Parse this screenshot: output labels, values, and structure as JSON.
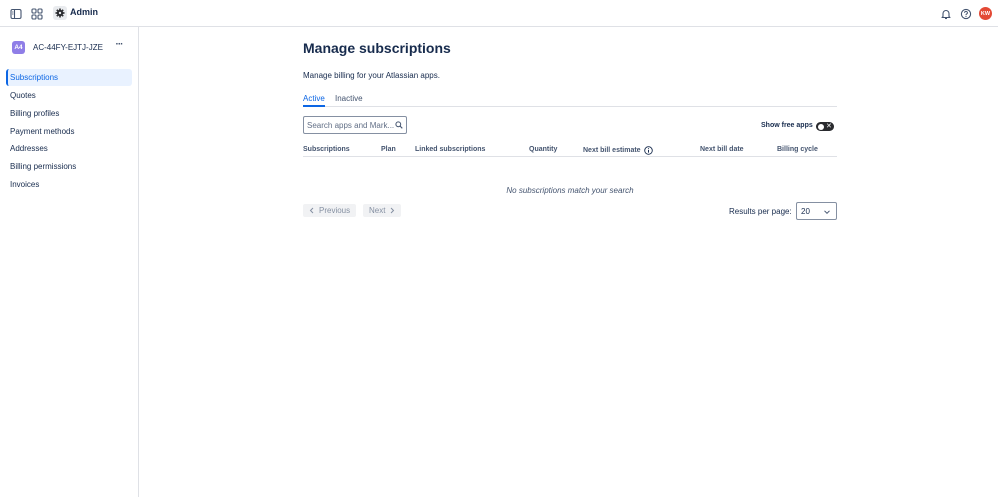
{
  "topbar": {
    "app_title": "Admin",
    "avatar_initials": "KW",
    "avatar_color": "#e34935",
    "icons": [
      "sidebar-toggle-icon",
      "app-switcher-icon",
      "gear-icon",
      "bell-icon",
      "help-icon"
    ]
  },
  "sidebar": {
    "org_badge": "A4",
    "org_badge_color": "#8f7ee7",
    "org_name": "AC-44FY-EJTJ-JZE",
    "more_label": "···",
    "items": [
      {
        "label": "Subscriptions",
        "active": true
      },
      {
        "label": "Quotes",
        "active": false
      },
      {
        "label": "Billing profiles",
        "active": false
      },
      {
        "label": "Payment methods",
        "active": false
      },
      {
        "label": "Addresses",
        "active": false
      },
      {
        "label": "Billing permissions",
        "active": false
      },
      {
        "label": "Invoices",
        "active": false
      }
    ]
  },
  "main": {
    "title": "Manage subscriptions",
    "description": "Manage billing for your Atlassian apps.",
    "tabs": [
      {
        "label": "Active",
        "active": true
      },
      {
        "label": "Inactive",
        "active": false
      }
    ],
    "search": {
      "placeholder": "Search apps and Mark...",
      "value": ""
    },
    "show_free_apps": {
      "label": "Show free apps",
      "enabled": false
    },
    "table": {
      "columns": [
        "Subscriptions",
        "Plan",
        "Linked subscriptions",
        "Quantity",
        "Next bill estimate",
        "Next bill date",
        "Billing cycle"
      ],
      "empty_message": "No subscriptions match your search"
    },
    "pagination": {
      "previous_label": "Previous",
      "next_label": "Next",
      "results_per_page_label": "Results per page:",
      "results_per_page_value": "20"
    }
  },
  "colors": {
    "accent": "#0c66e4",
    "text": "#172b4d",
    "muted": "#44546f",
    "border": "#dfe1e6"
  }
}
